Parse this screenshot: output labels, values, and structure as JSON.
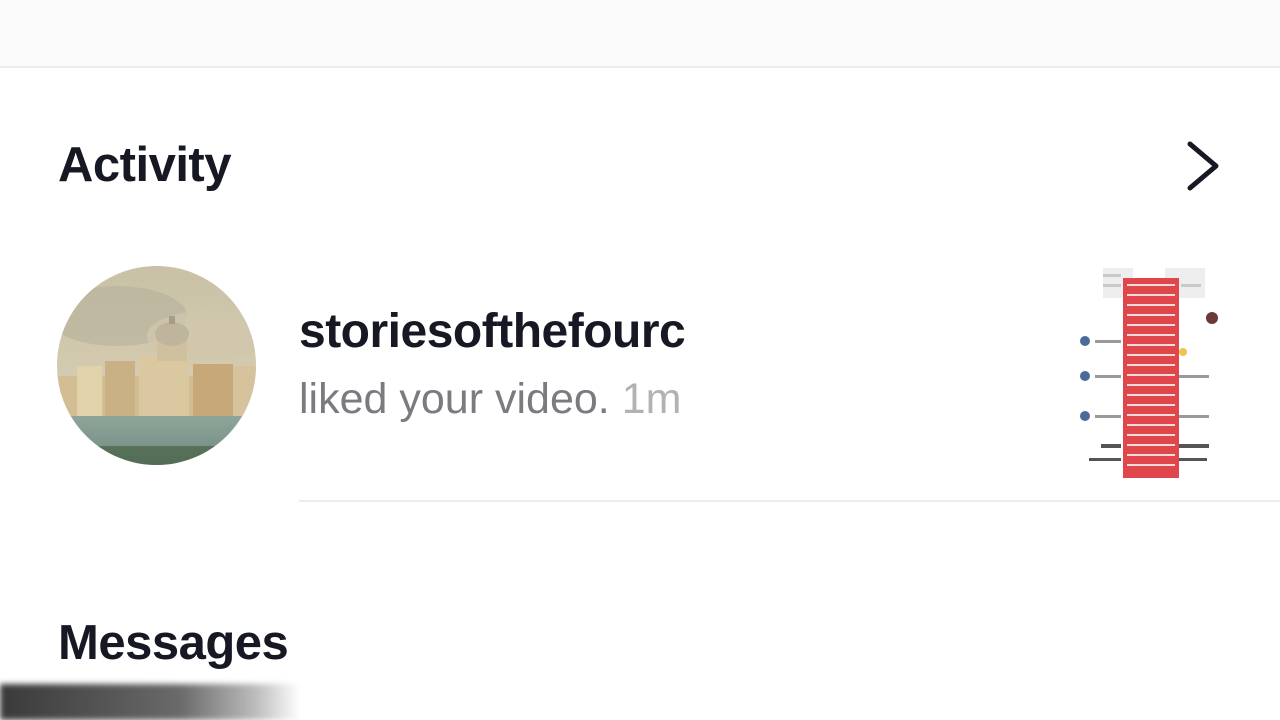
{
  "activity": {
    "title": "Activity",
    "chevron_icon": "chevron-right-icon"
  },
  "notification": {
    "username": "storiesofthefourc",
    "action": "liked your video.",
    "time": "1m",
    "avatar_icon": "avatar-image",
    "thumbnail_icon": "video-thumbnail"
  },
  "messages": {
    "title": "Messages"
  },
  "colors": {
    "primary_text": "#161823",
    "secondary_text": "#7a7a80",
    "time_text": "#b2b2b6",
    "divider": "#ededed",
    "thumbnail_accent": "#e0474c"
  }
}
